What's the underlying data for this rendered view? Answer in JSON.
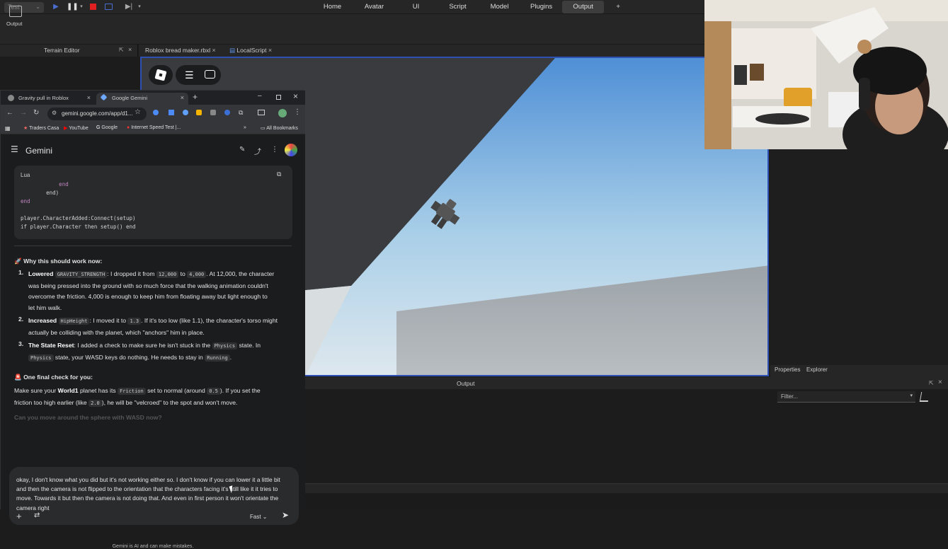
{
  "topbar": {
    "test_select": "Test",
    "tabs": [
      "Home",
      "Avatar",
      "UI",
      "Script",
      "Model",
      "Plugins",
      "Output"
    ],
    "active_tab": "Output",
    "plus": "+"
  },
  "ribbon": {
    "output_label": "Output"
  },
  "left_panel": {
    "title": "Terrain Editor"
  },
  "doc_tabs": [
    {
      "label": "Roblox bread maker.rbxl"
    },
    {
      "label": "LocalScript"
    }
  ],
  "right_panel": {
    "tabs": [
      "Properties",
      "Explorer"
    ]
  },
  "output_panel": {
    "title": "Output",
    "filter_placeholder": "Filter..."
  },
  "browser": {
    "tabs": [
      {
        "label": "Gravity pull in Roblox"
      },
      {
        "label": "Google Gemini"
      }
    ],
    "url": "gemini.google.com/app/d1...",
    "bookmarks": [
      "Traders Casa",
      "YouTube",
      "Google",
      "Internet Speed Test |...",
      "All Bookmarks"
    ]
  },
  "gemini": {
    "title": "Gemini",
    "code": {
      "lang": "Lua",
      "lines": [
        "            end",
        "        end)",
        "end",
        "",
        "player.CharacterAdded:Connect(setup)",
        "if player.Character then setup() end"
      ]
    },
    "why_heading": "🚀 Why this should work now:",
    "items": [
      {
        "num": "1.",
        "lead": "Lowered",
        "code": "GRAVITY_STRENGTH",
        "t1": ": I dropped it from",
        "c2": "12,000",
        "t2": "to",
        "c3": "4,000",
        "t3": ". At 12,000, the character",
        "l2": "was being pressed into the ground with so much force that the walking animation couldn't",
        "l3": "overcome the friction. 4,000 is enough to keep him from floating away but light enough to",
        "l4": "let him walk."
      },
      {
        "num": "2.",
        "lead": "Increased",
        "code": "HipHeight",
        "t1": ": I moved it to",
        "c2": "1.3",
        "t2": ". If it's too low (like 1.1), the character's torso might",
        "l2": "actually be colliding with the planet, which \"anchors\" him in place."
      },
      {
        "num": "3.",
        "lead": "The State Reset",
        "t1": ": I added a check to make sure he isn't stuck in the",
        "c2": "Physics",
        "t2": "state. In",
        "c3": "Physics",
        "t3": "state, your WASD keys do nothing. He needs to stay in",
        "c4": "Running",
        "t4": "."
      }
    ],
    "final_heading": "🚨 One final check for you:",
    "final": {
      "t1": "Make sure your",
      "b1": "World1",
      "t2": "planet has its",
      "c1": "Friction",
      "t3": "set to normal (around",
      "c2": "0.5",
      "t4": "). If you set the",
      "t5": "friction too high earlier (like",
      "c3": "2.0",
      "t6": "), he will be \"velcroed\" to the spot and won't move."
    },
    "faded": "Can you move around the sphere with WASD now?",
    "input": "okay, I don't know what you did but it's not working either so. I don't know if you can lower it a little bit and then the camera is not flipped to the orientation that the characters facing it's still like it it tries to move. Towards it but then the camera is not doing that. And even in first person it won't orientate the camera right",
    "mode": "Fast",
    "disclaimer": "Gemini is AI and can make mistakes."
  }
}
